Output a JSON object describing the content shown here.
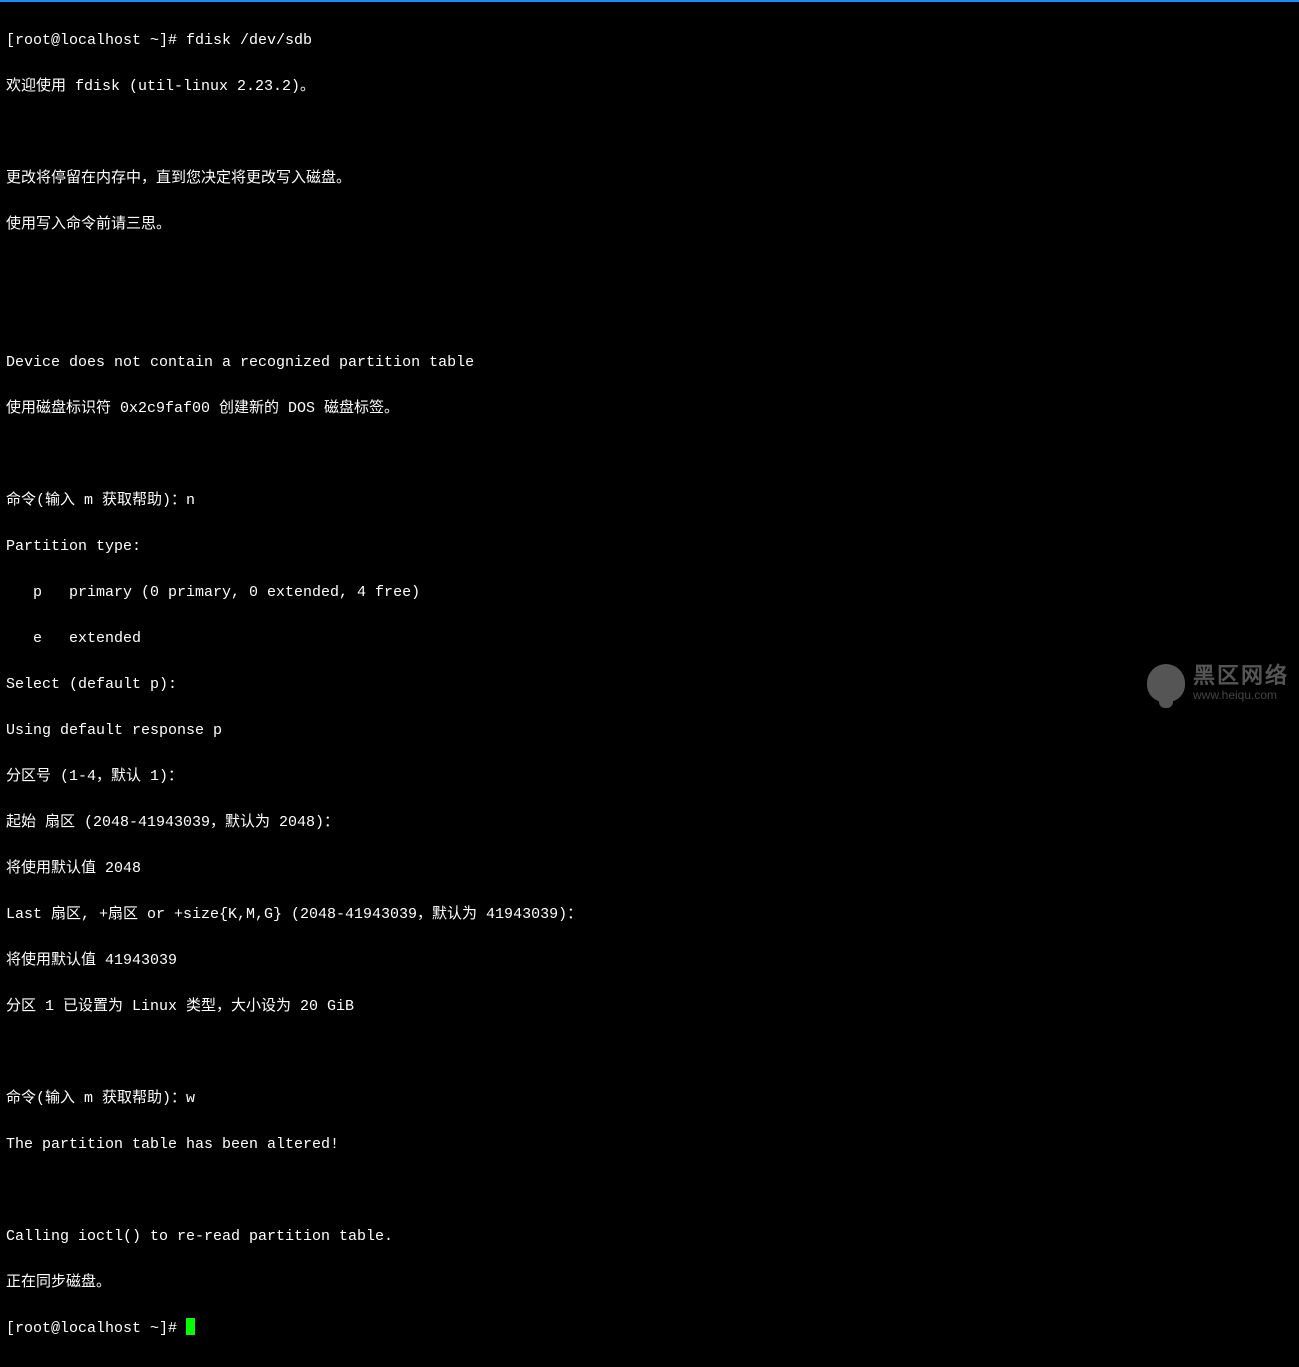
{
  "prompt1": "[root@localhost ~]# ",
  "cmd1": "fdisk /dev/sdb",
  "lines": {
    "l1": "欢迎使用 fdisk (util-linux 2.23.2)。",
    "l2": "",
    "l3": "更改将停留在内存中，直到您决定将更改写入磁盘。",
    "l4": "使用写入命令前请三思。",
    "l5": "",
    "l6": "",
    "l7": "Device does not contain a recognized partition table",
    "l8": "使用磁盘标识符 0x2c9faf00 创建新的 DOS 磁盘标签。",
    "l9": "",
    "l10": "命令(输入 m 获取帮助)：n",
    "l11": "Partition type:",
    "l12": "   p   primary (0 primary, 0 extended, 4 free)",
    "l13": "   e   extended",
    "l14": "Select (default p): ",
    "l15": "Using default response p",
    "l16": "分区号 (1-4，默认 1)：",
    "l17": "起始 扇区 (2048-41943039，默认为 2048)：",
    "l18": "将使用默认值 2048",
    "l19": "Last 扇区, +扇区 or +size{K,M,G} (2048-41943039，默认为 41943039)：",
    "l20": "将使用默认值 41943039",
    "l21": "分区 1 已设置为 Linux 类型，大小设为 20 GiB",
    "l22": "",
    "l23": "命令(输入 m 获取帮助)：w",
    "l24": "The partition table has been altered!",
    "l25": "",
    "l26": "Calling ioctl() to re-read partition table.",
    "l27": "正在同步磁盘。"
  },
  "prompt2": "[root@localhost ~]# ",
  "watermark": {
    "main": "黑区网络",
    "sub": "www.heiqu.com"
  }
}
